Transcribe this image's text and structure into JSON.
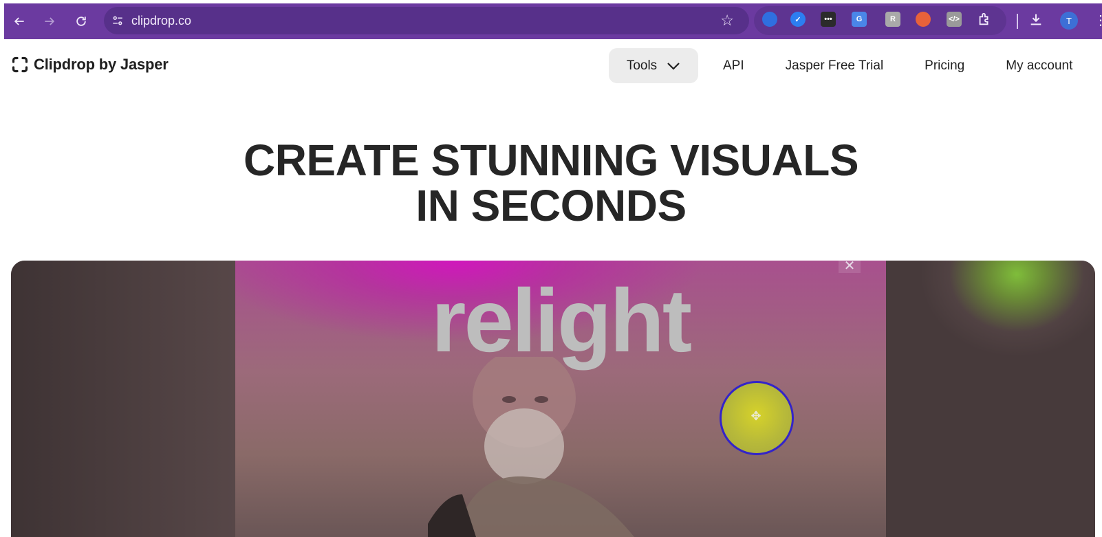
{
  "browser": {
    "url": "clipdrop.co",
    "avatar_letter": "T",
    "colors": {
      "frame": "#6b3aa0",
      "omnibox": "#57308a"
    }
  },
  "header": {
    "logo_text": "Clipdrop by Jasper",
    "nav": {
      "tools": "Tools",
      "api": "API",
      "trial": "Jasper Free Trial",
      "pricing": "Pricing",
      "account": "My account"
    }
  },
  "hero": {
    "title_line1": "CREATE STUNNING VISUALS",
    "title_line2": "IN SECONDS"
  },
  "demo": {
    "overlay_text": "relight",
    "close_symbol": "✕"
  },
  "icons": [
    "back-icon",
    "forward-icon",
    "reload-icon",
    "tune-icon",
    "star-icon",
    "download-icon",
    "extensions-icon",
    "menu-icon"
  ]
}
